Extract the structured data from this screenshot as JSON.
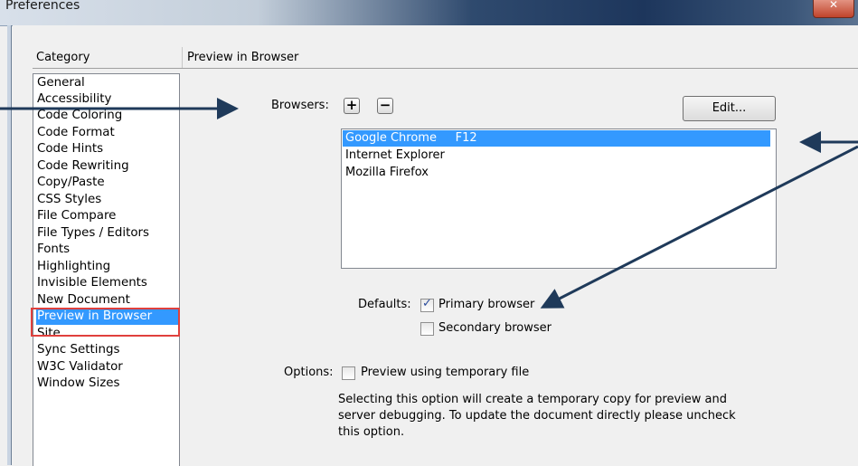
{
  "window": {
    "title": "Preferences"
  },
  "category": {
    "header": "Category",
    "items": [
      "General",
      "Accessibility",
      "Code Coloring",
      "Code Format",
      "Code Hints",
      "Code Rewriting",
      "Copy/Paste",
      "CSS Styles",
      "File Compare",
      "File Types / Editors",
      "Fonts",
      "Highlighting",
      "Invisible Elements",
      "New Document",
      "Preview in Browser",
      "Site",
      "Sync Settings",
      "W3C Validator",
      "Window Sizes"
    ],
    "selected": "Preview in Browser"
  },
  "pane": {
    "title": "Preview in Browser",
    "browsers_label": "Browsers:",
    "add_icon": "+",
    "remove_icon": "−",
    "edit_label": "Edit...",
    "browser_list": [
      {
        "name": "Google Chrome     F12",
        "selected": true
      },
      {
        "name": "Internet Explorer",
        "selected": false
      },
      {
        "name": "Mozilla Firefox",
        "selected": false
      }
    ],
    "defaults_label": "Defaults:",
    "primary_label": "Primary browser",
    "primary_checked": true,
    "secondary_label": "Secondary browser",
    "secondary_checked": false,
    "options_label": "Options:",
    "temp_file_label": "Preview using temporary file",
    "temp_file_checked": false,
    "description_lines": [
      "Selecting this option will create a temporary copy for preview and",
      "server debugging. To update the document directly please uncheck",
      "this option."
    ]
  },
  "colors": {
    "selection": "#3399ff",
    "highlight_box": "#e0403c",
    "arrow": "#1f3a5a"
  },
  "icons": [
    "plus-icon",
    "minus-icon",
    "checkmark-icon",
    "close-icon"
  ]
}
